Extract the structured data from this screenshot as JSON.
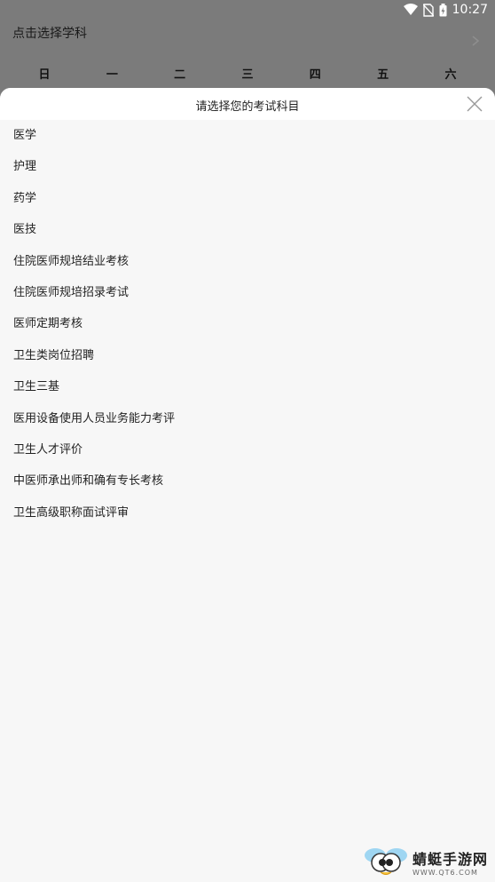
{
  "status_bar": {
    "time": "10:27"
  },
  "background": {
    "title": "点击选择学科",
    "weekdays": [
      "日",
      "一",
      "二",
      "三",
      "四",
      "五",
      "六"
    ]
  },
  "sheet": {
    "title": "请选择您的考试科目",
    "items": [
      "医学",
      "护理",
      "药学",
      "医技",
      "住院医师规培结业考核",
      "住院医师规培招录考试",
      "医师定期考核",
      "卫生类岗位招聘",
      "卫生三基",
      "医用设备使用人员业务能力考评",
      "卫生人才评价",
      "中医师承出师和确有专长考核",
      "卫生高级职称面试评审"
    ]
  },
  "watermark": {
    "name": "蜻蜓手游网",
    "url": "WWW.QT6.COM"
  }
}
